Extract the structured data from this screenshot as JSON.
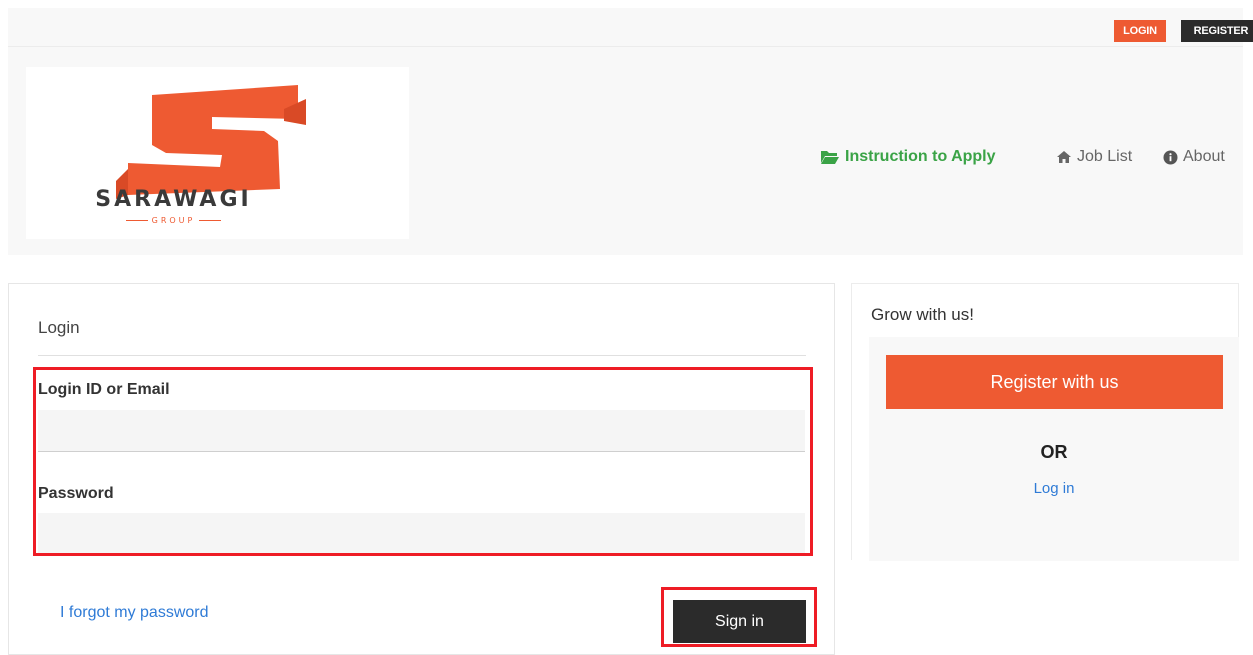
{
  "topbar": {
    "login_label": "LOGIN",
    "register_label": "REGISTER"
  },
  "header": {
    "logo_text": "SARAWAGI",
    "logo_subtext": "GROUP",
    "nav": [
      {
        "label": "Instruction to Apply",
        "icon": "folder-open-icon"
      },
      {
        "label": "Job List",
        "icon": "home-icon"
      },
      {
        "label": "About",
        "icon": "info-circle-icon"
      }
    ]
  },
  "login_form": {
    "title": "Login",
    "login_id_label": "Login ID or Email",
    "login_id_value": "",
    "password_label": "Password",
    "password_value": "",
    "forgot_link": "I forgot my password",
    "submit_label": "Sign in"
  },
  "sidebar": {
    "title": "Grow with us!",
    "register_button": "Register with us",
    "or_text": "OR",
    "login_link": "Log in"
  },
  "colors": {
    "accent": "#ee5a32",
    "dark": "#2b2b2b",
    "link": "#2f7bd6",
    "nav_active": "#3aa346",
    "highlight": "#ee1c25"
  }
}
